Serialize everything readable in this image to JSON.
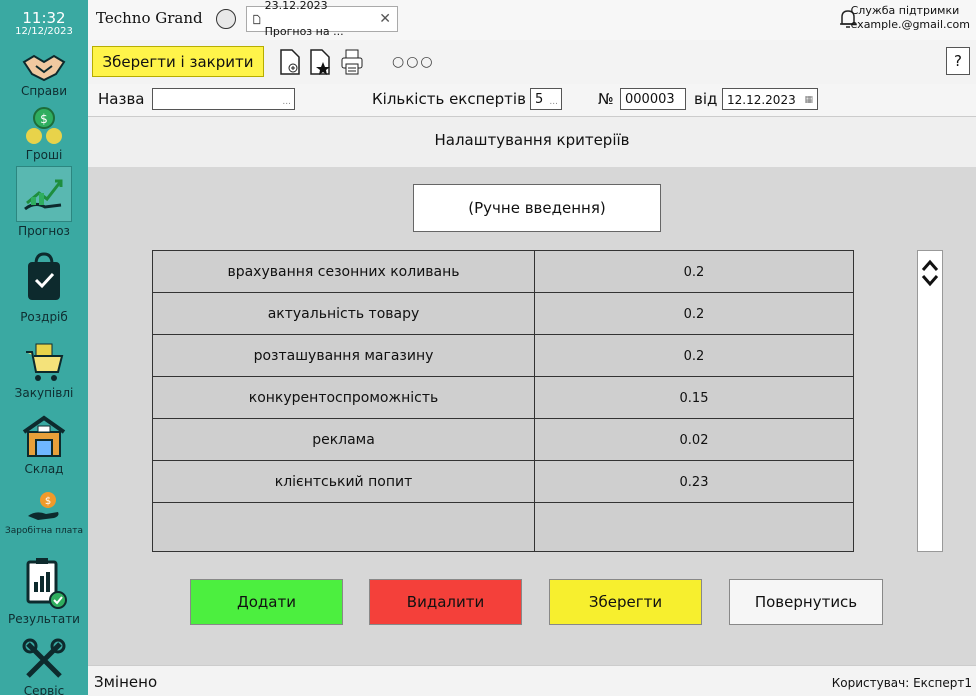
{
  "clock": {
    "time": "11:32",
    "date": "12/12/2023"
  },
  "sidebar": {
    "items": [
      {
        "label": "Справи",
        "icon": "handshake-icon"
      },
      {
        "label": "Гроші",
        "icon": "money-icon"
      },
      {
        "label": "Прогноз",
        "icon": "forecast-icon",
        "active": true
      },
      {
        "label": "Роздріб",
        "icon": "shopping-bag-icon"
      },
      {
        "label": "Закупівлі",
        "icon": "cart-icon"
      },
      {
        "label": "Склад",
        "icon": "warehouse-icon"
      },
      {
        "label": "Заробітна плата",
        "icon": "salary-icon"
      },
      {
        "label": "Результати",
        "icon": "report-icon"
      },
      {
        "label": "Сервіс",
        "icon": "tools-icon"
      }
    ]
  },
  "topbar": {
    "brand": "Techno Grand",
    "doc_tab": "23.12.2023 Прогноз на ...",
    "support_title": "Служба підтримки",
    "support_email": "example.@gmail.com"
  },
  "toolbar": {
    "save_close": "Зберегти і закрити",
    "more": "○○○",
    "help": "?"
  },
  "form": {
    "name_label": "Назва",
    "name_value": "",
    "experts_label": "Кількість експертів",
    "experts_value": "5",
    "number_label": "№",
    "number_value": "000003",
    "from_label": "від",
    "date_value": "12.12.2023"
  },
  "section_title": "Налаштування критеріїв",
  "mode": "(Ручне введення)",
  "criteria": {
    "rows": [
      {
        "name": "врахування сезонних коливань",
        "value": "0.2"
      },
      {
        "name": "актуальність товару",
        "value": "0.2"
      },
      {
        "name": "розташування магазину",
        "value": "0.2"
      },
      {
        "name": "конкурентоспроможність",
        "value": "0.15"
      },
      {
        "name": "реклама",
        "value": "0.02"
      },
      {
        "name": "клієнтський попит",
        "value": "0.23"
      },
      {
        "name": "",
        "value": ""
      }
    ]
  },
  "buttons": {
    "add": "Додати",
    "delete": "Видалити",
    "save": "Зберегти",
    "back": "Повернутись"
  },
  "status": {
    "left": "Змінено",
    "user": "Користувач: Експерт1"
  },
  "colors": {
    "sidebar": "#3aa9a2",
    "add": "#4cef3f",
    "delete": "#f4403a",
    "save": "#f7ef2e",
    "save_close": "#fff44a"
  }
}
